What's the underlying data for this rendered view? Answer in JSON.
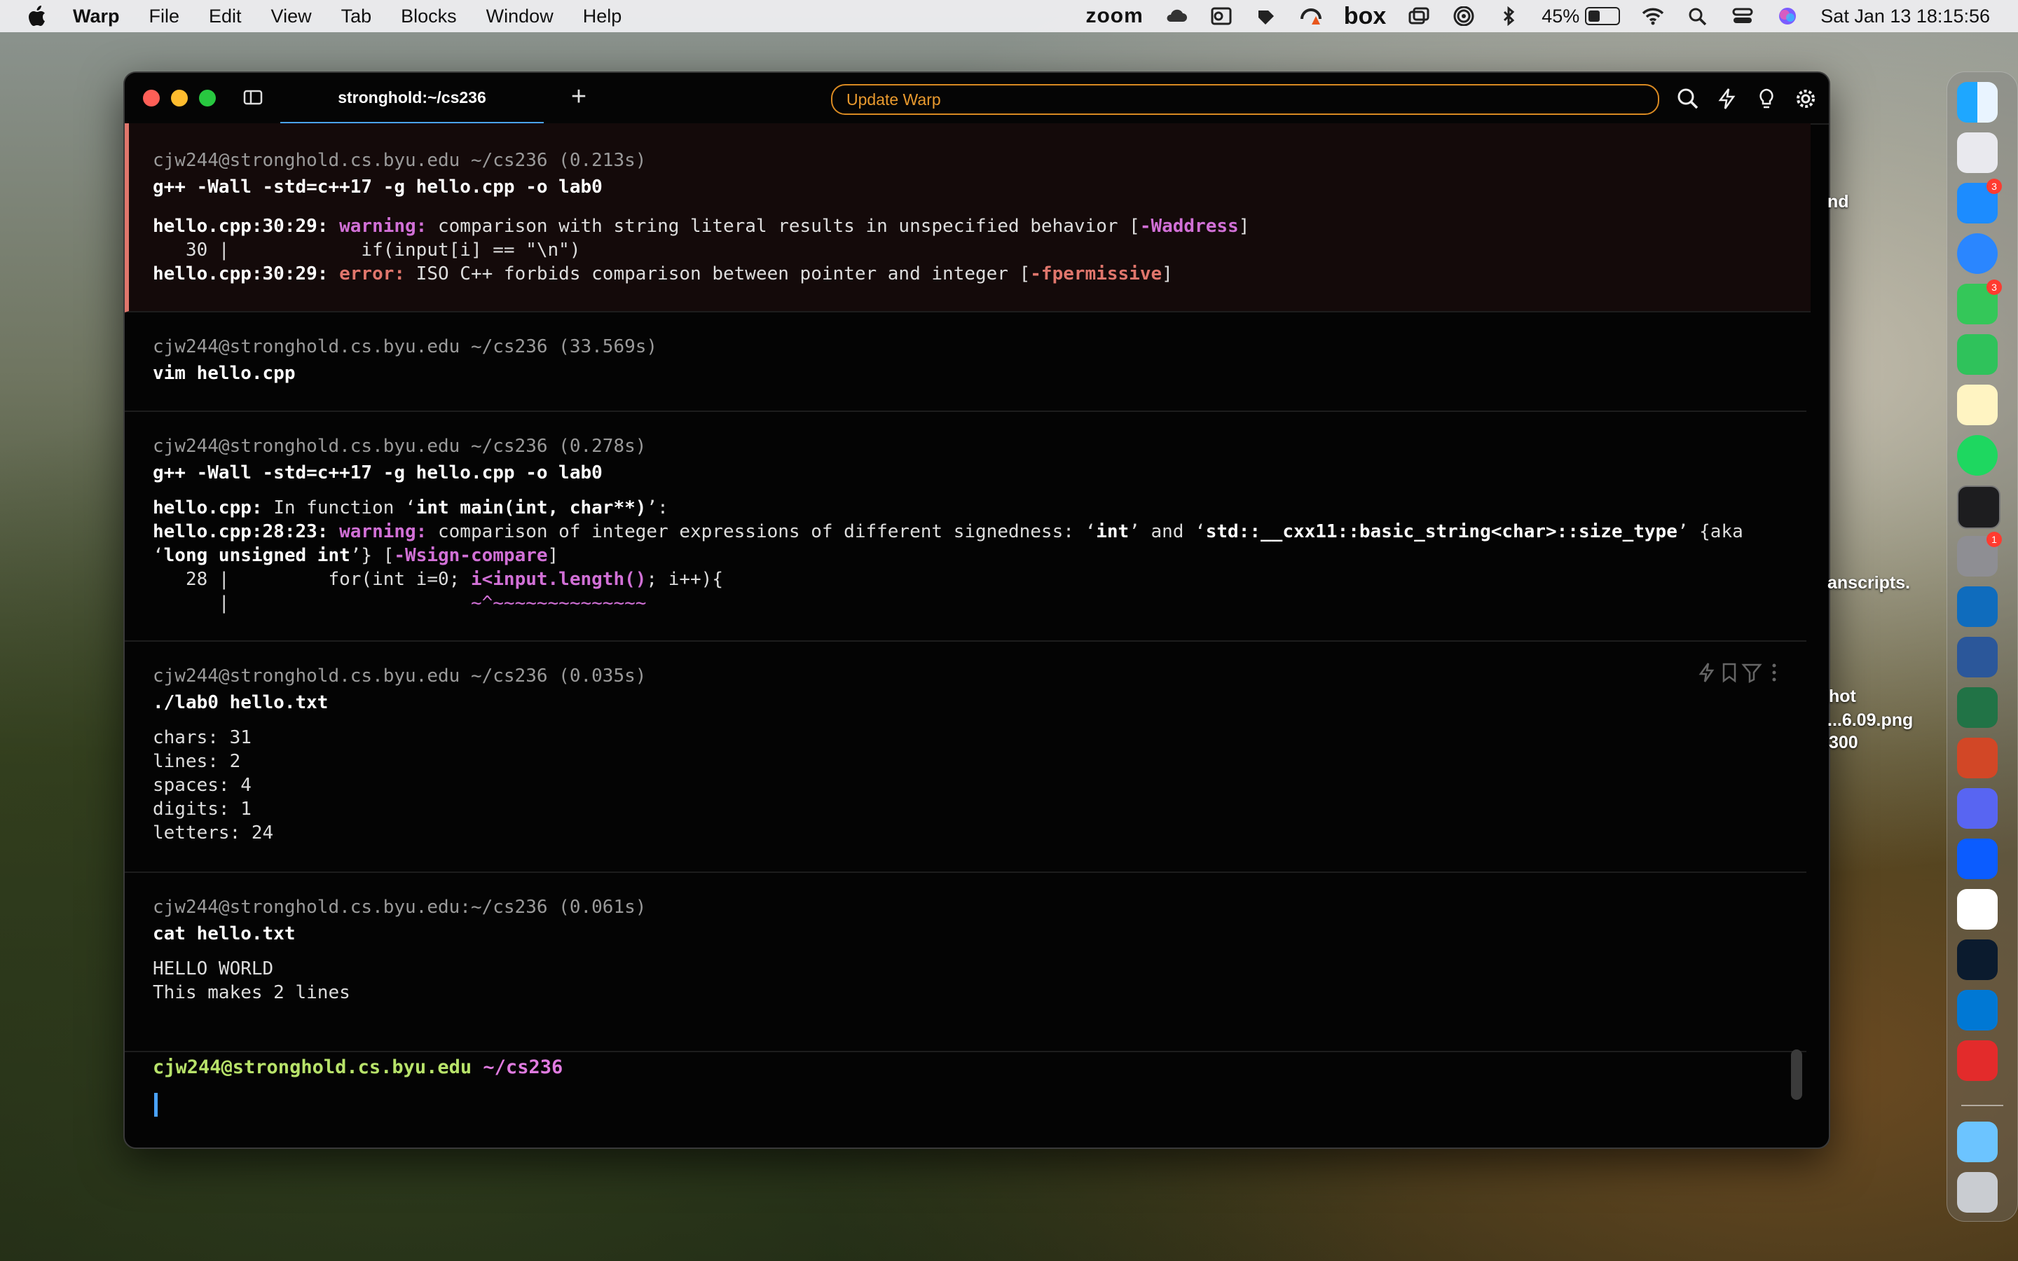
{
  "menubar": {
    "app_name": "Warp",
    "menus": [
      "File",
      "Edit",
      "View",
      "Tab",
      "Blocks",
      "Window",
      "Help"
    ],
    "zoom_label": "zoom",
    "box_label": "box",
    "battery_percent": "45%",
    "battery_level": 0.45,
    "datetime": "Sat Jan 13  18:15:56"
  },
  "window": {
    "tab_title": "stronghold:~/cs236",
    "update_button": "Update Warp"
  },
  "blocks": [
    {
      "prompt": "cjw244@stronghold.cs.byu.edu ~/cs236 (0.213s)",
      "command": "g++ -Wall -std=c++17 -g hello.cpp -o lab0",
      "l1_file": "hello.cpp:30:29:",
      "l1_kind": "warning:",
      "l1_msg": " comparison with string literal results in unspecified behavior [",
      "l1_flag": "-Waddress",
      "l1_end": "]",
      "l2": "   30 |            if(input[i] == \"\\n\")",
      "l3_file": "hello.cpp:30:29:",
      "l3_kind": "error:",
      "l3_msg": " ISO C++ forbids comparison between pointer and integer [",
      "l3_flag": "-fpermissive",
      "l3_end": "]"
    },
    {
      "prompt": "cjw244@stronghold.cs.byu.edu ~/cs236 (33.569s)",
      "command": "vim hello.cpp"
    },
    {
      "prompt": "cjw244@stronghold.cs.byu.edu ~/cs236 (0.278s)",
      "command": "g++ -Wall -std=c++17 -g hello.cpp -o lab0",
      "l1_file": "hello.cpp:",
      "l1_pre": " In function ‘",
      "l1_fn": "int main(int, char**)",
      "l1_post": "’:",
      "l2_file": "hello.cpp:28:23:",
      "l2_kind": "warning:",
      "l2_msg": " comparison of integer expressions of different signedness: ‘",
      "l2_t1": "int",
      "l2_mid": "’ and ‘",
      "l2_t2": "std::__cxx11::basic_string<char>::size_type",
      "l2_tail": "’ {aka",
      "l3_pre": "‘",
      "l3_t": "long unsigned int",
      "l3_mid": "’} [",
      "l3_flag": "-Wsign-compare",
      "l3_end": "]",
      "l4_pre": "   28 |         for(int i=0; ",
      "l4_hl": "i<input.length()",
      "l4_post": "; i++){",
      "l5_pre": "      |                      ",
      "l5_hl": "~^~~~~~~~~~~~~~~"
    },
    {
      "prompt": "cjw244@stronghold.cs.byu.edu ~/cs236 (0.035s)",
      "command": "./lab0 hello.txt",
      "output": [
        "chars: 31",
        "lines: 2",
        "spaces: 4",
        "digits: 1",
        "letters: 24"
      ]
    },
    {
      "prompt": "cjw244@stronghold.cs.byu.edu:~/cs236 (0.061s)",
      "command": "cat hello.txt",
      "output": [
        "HELLO WORLD",
        "This makes 2 lines"
      ]
    }
  ],
  "current_prompt": {
    "host": "cjw244@stronghold.cs.byu.edu",
    "dir": "~/cs236"
  },
  "desktop_labels": {
    "a": "nd",
    "b": "anscripts.",
    "c": "hot",
    "d": "...6.09.png",
    "e": "300"
  },
  "dock": {
    "badges": {
      "app_store": "3",
      "messages": "3",
      "system_settings": "1"
    }
  },
  "colors": {
    "accent": "#4aa3ff",
    "warning": "#d170d6",
    "error": "#e0766c",
    "prompt_host": "#b8e36a",
    "update": "#e99a2e"
  }
}
